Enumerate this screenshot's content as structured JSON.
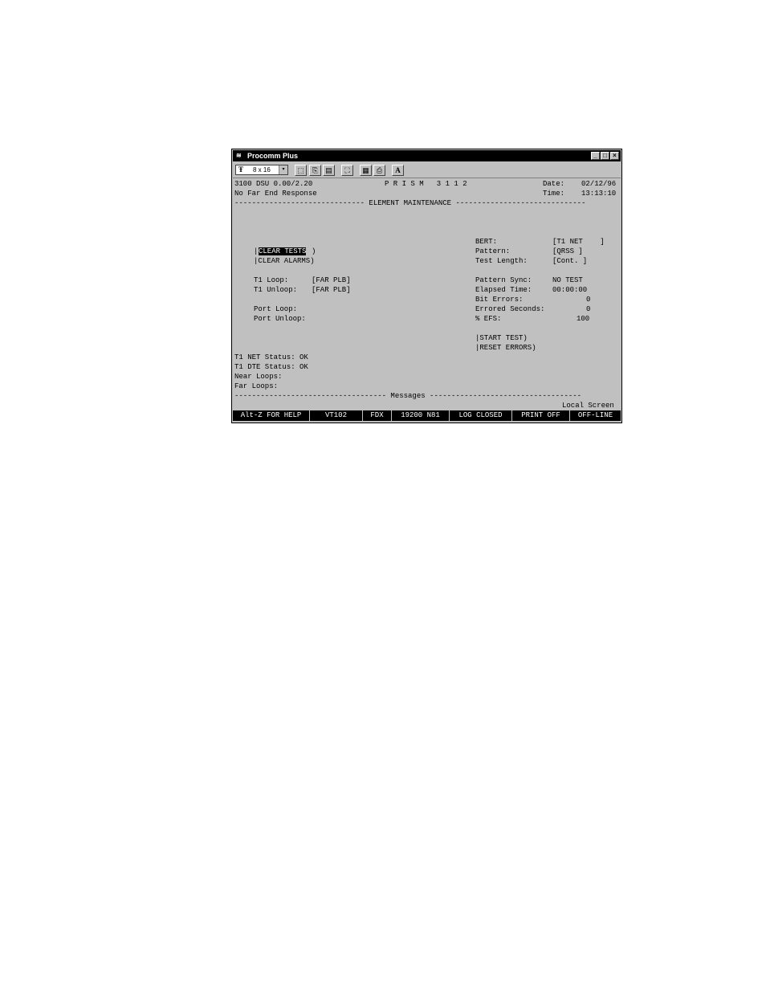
{
  "window": {
    "title": "Procomm Plus",
    "icon": "procomm-logo-icon",
    "buttons": {
      "minimize": "_",
      "maximize": "□",
      "close": "×"
    }
  },
  "toolbar": {
    "font_icon": "Ŧ",
    "font_size": "8 x 16",
    "dropdown_arrow": "▾",
    "buttons": [
      {
        "name": "select-icon",
        "glyph": "⬚"
      },
      {
        "name": "copy-icon",
        "glyph": "⎘"
      },
      {
        "name": "paste-icon",
        "glyph": "▤"
      },
      {
        "name": "fullscreen-icon",
        "glyph": "⛶"
      },
      {
        "name": "properties-icon",
        "glyph": "▦"
      },
      {
        "name": "print-icon",
        "glyph": "⎙"
      },
      {
        "name": "font-icon",
        "glyph": "A"
      }
    ]
  },
  "terminal": {
    "device": "3100 DSU 0.00/2.20",
    "product": "P R I S M   3 1 1 2",
    "date_label": "Date:",
    "date_value": "02/12/96",
    "response": "No Far End Response",
    "time_label": "Time:",
    "time_value": "13:13:10",
    "section_title": "------------------------------ ELEMENT MAINTENANCE ------------------------------",
    "left": {
      "clear_tests": "CLEAR TESTS",
      "clear_tests_bracket_open": "|",
      "clear_tests_bracket_close": ")",
      "clear_alarms": "|CLEAR ALARMS)",
      "t1_loop_label": "T1 Loop:",
      "t1_loop_value": "[FAR PLB]",
      "t1_unloop_label": "T1 Unloop:",
      "t1_unloop_value": "[FAR PLB]",
      "port_loop_label": "Port Loop:",
      "port_unloop_label": "Port Unloop:"
    },
    "right": {
      "bert_label": "BERT:",
      "bert_value": "[T1 NET    ]",
      "pattern_label": "Pattern:",
      "pattern_value": "[QRSS ]",
      "test_length_label": "Test Length:",
      "test_length_value": "[Cont. ]",
      "pattern_sync_label": "Pattern Sync:",
      "pattern_sync_value": "NO TEST",
      "elapsed_label": "Elapsed Time:",
      "elapsed_value": "00:00:00",
      "bit_errors_label": "Bit Errors:",
      "bit_errors_value": "0",
      "errored_seconds_label": "Errored Seconds:",
      "errored_seconds_value": "0",
      "efs_label": "% EFS:",
      "efs_value": "100",
      "start_test": "|START TEST)",
      "reset_errors": "|RESET ERRORS)"
    },
    "status": {
      "t1_net": "T1 NET Status: OK",
      "t1_dte": "T1 DTE Status: OK",
      "near_loops": "Near Loops:",
      "far_loops": "Far Loops:"
    },
    "messages_divider": "----------------------------------- Messages -----------------------------------",
    "local_screen": "Local Screen"
  },
  "statusbar": {
    "help": "Alt-Z FOR HELP",
    "emulation": "VT102",
    "duplex": "FDX",
    "baud": "19200 N81",
    "log": "LOG CLOSED",
    "print": "PRINT OFF",
    "line": "OFF-LINE"
  }
}
